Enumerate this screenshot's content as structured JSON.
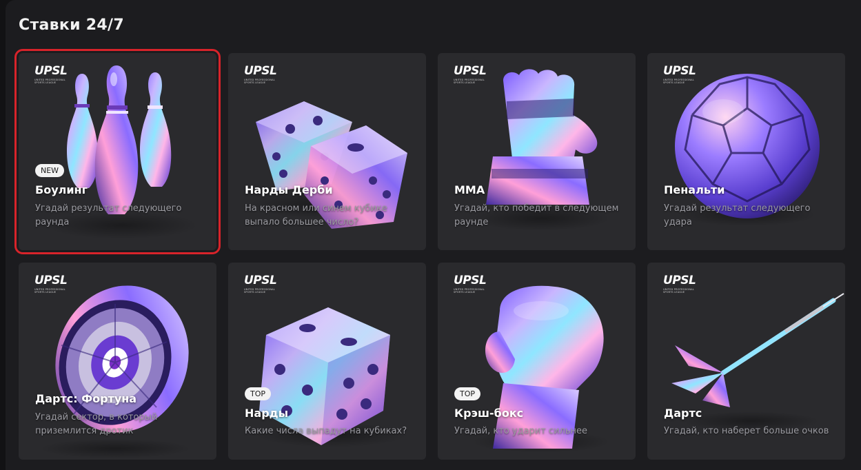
{
  "section": {
    "title": "Ставки 24/7"
  },
  "brand": {
    "logo_text": "UPSL",
    "logo_subtitle": "UNITED PROFESSIONAL SPORTS LEAGUE"
  },
  "colors": {
    "selection_outline": "#d8232a",
    "card_bg": "#2a2a2d",
    "badge_bg": "#f3f3f3"
  },
  "games": [
    {
      "title": "Боулинг",
      "description": "Угадай результат следующего раунда",
      "badge": "NEW",
      "icon": "bowling-pins-icon",
      "selected": true
    },
    {
      "title": "Нарды Дерби",
      "description": "На красном или синем кубике выпало большее число?",
      "badge": "",
      "icon": "two-dice-icon",
      "selected": false
    },
    {
      "title": "MMA",
      "description": "Угадай, кто победит в следующем раунде",
      "badge": "",
      "icon": "mma-glove-icon",
      "selected": false
    },
    {
      "title": "Пенальти",
      "description": "Угадай результат следующего удара",
      "badge": "",
      "icon": "soccer-ball-icon",
      "selected": false
    },
    {
      "title": "Дартс: Фортуна",
      "description": "Угадай сектор, в который приземлится дротик",
      "badge": "",
      "icon": "roulette-wheel-icon",
      "selected": false
    },
    {
      "title": "Нарды",
      "description": "Какие числа выпадут на кубиках?",
      "badge": "TOP",
      "icon": "dice-icon",
      "selected": false
    },
    {
      "title": "Крэш-бокс",
      "description": "Угадай, кто ударит сильнее",
      "badge": "TOP",
      "icon": "boxing-glove-icon",
      "selected": false
    },
    {
      "title": "Дартс",
      "description": "Угадай, кто наберет больше очков",
      "badge": "",
      "icon": "dart-icon",
      "selected": false
    }
  ]
}
